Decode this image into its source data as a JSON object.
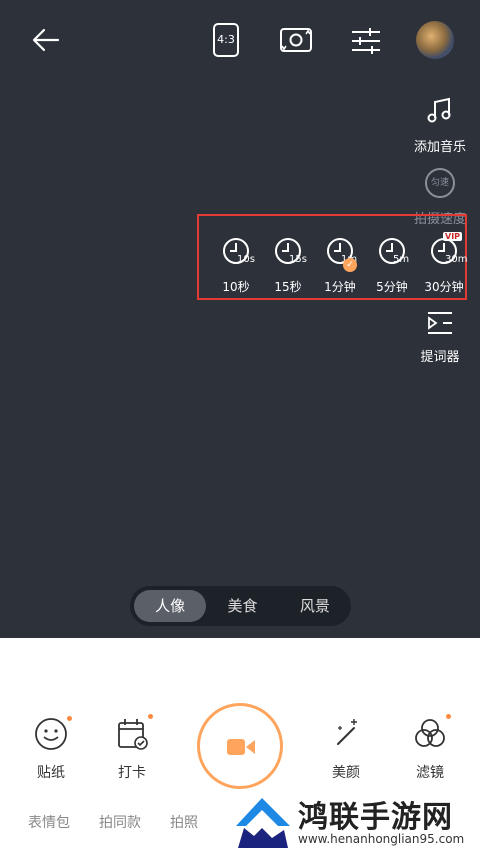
{
  "top_bar": {
    "aspect_label": "4:3"
  },
  "right_tools": {
    "add_music": "添加音乐",
    "speed_badge": "匀速",
    "speed_label": "拍摄速度",
    "teleprompter": "提词器"
  },
  "durations": [
    {
      "clock_text": "10s",
      "label": "10秒"
    },
    {
      "clock_text": "15s",
      "label": "15秒"
    },
    {
      "clock_text": "1m",
      "label": "1分钟",
      "selected": true
    },
    {
      "clock_text": "5m",
      "label": "5分钟"
    },
    {
      "clock_text": "30m",
      "label": "30分钟",
      "badge": "VIP"
    }
  ],
  "modes": [
    "人像",
    "美食",
    "风景"
  ],
  "bottom_tools": {
    "sticker": "贴纸",
    "checkin": "打卡",
    "beauty": "美颜",
    "filter": "滤镜"
  },
  "tabs": [
    "表情包",
    "拍同款",
    "拍照"
  ],
  "watermark": {
    "title": "鸿联手游网",
    "url": "www.henanhonglian95.com"
  },
  "colors": {
    "camera_bg": "#2c313a",
    "accent": "#ffa45c",
    "highlight_box": "#e53935"
  }
}
